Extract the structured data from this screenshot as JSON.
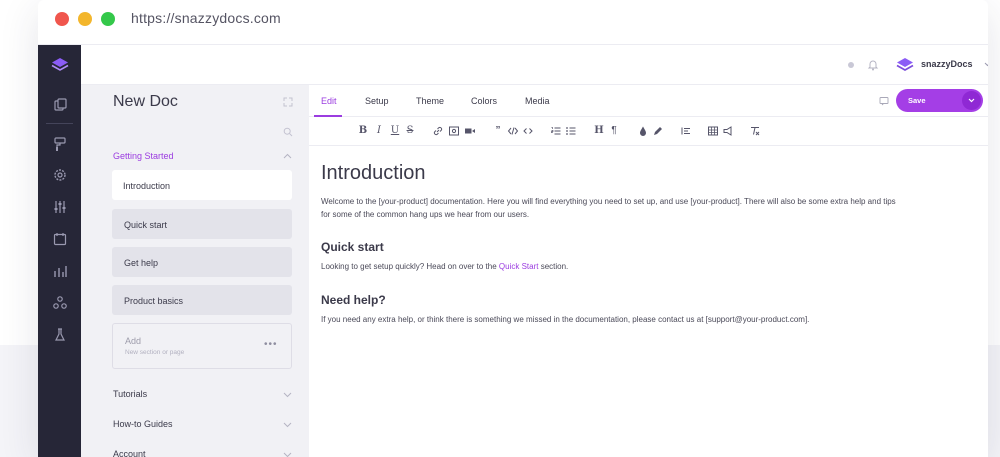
{
  "browser": {
    "url": "https://snazzydocs.com"
  },
  "rail": {
    "icons": [
      "layers-logo-icon",
      "pages-icon",
      "brush-icon",
      "gear-icon",
      "sliders-icon",
      "calendar-icon",
      "bar-chart-icon",
      "share-icon",
      "lab-icon"
    ]
  },
  "header": {
    "brand": "snazzyDocs"
  },
  "sidebar": {
    "doc_title": "New Doc",
    "sections": [
      {
        "label": "Getting Started",
        "expanded": true
      },
      {
        "label": "Tutorials",
        "expanded": false
      },
      {
        "label": "How-to Guides",
        "expanded": false
      },
      {
        "label": "Account",
        "expanded": false
      }
    ],
    "items": [
      "Introduction",
      "Quick start",
      "Get help",
      "Product basics"
    ],
    "add": {
      "label": "Add",
      "sub": "New section or page",
      "more": "•••"
    }
  },
  "tabs": [
    "Edit",
    "Setup",
    "Theme",
    "Colors",
    "Media"
  ],
  "save": {
    "label": "Save"
  },
  "colors": {
    "accent": "#9b3ce0",
    "rail": "#262637",
    "sidebar": "#f1f1f5"
  },
  "content": {
    "title": "Introduction",
    "intro_line1": "Welcome to the [your-product] documentation. Here you will find everything you need to set up, and use [your-product]. There will also be some extra help and tips",
    "intro_line2": "for some of the common hang ups we hear from our users.",
    "quick_heading": "Quick start",
    "quick_text_before": "Looking to get setup quickly? Head on over to the ",
    "quick_link": "Quick Start",
    "quick_text_after": " section.",
    "help_heading": "Need help?",
    "help_text": "If you need any extra help, or think there is something we missed in the documentation, please contact us at [support@your-product.com]."
  }
}
